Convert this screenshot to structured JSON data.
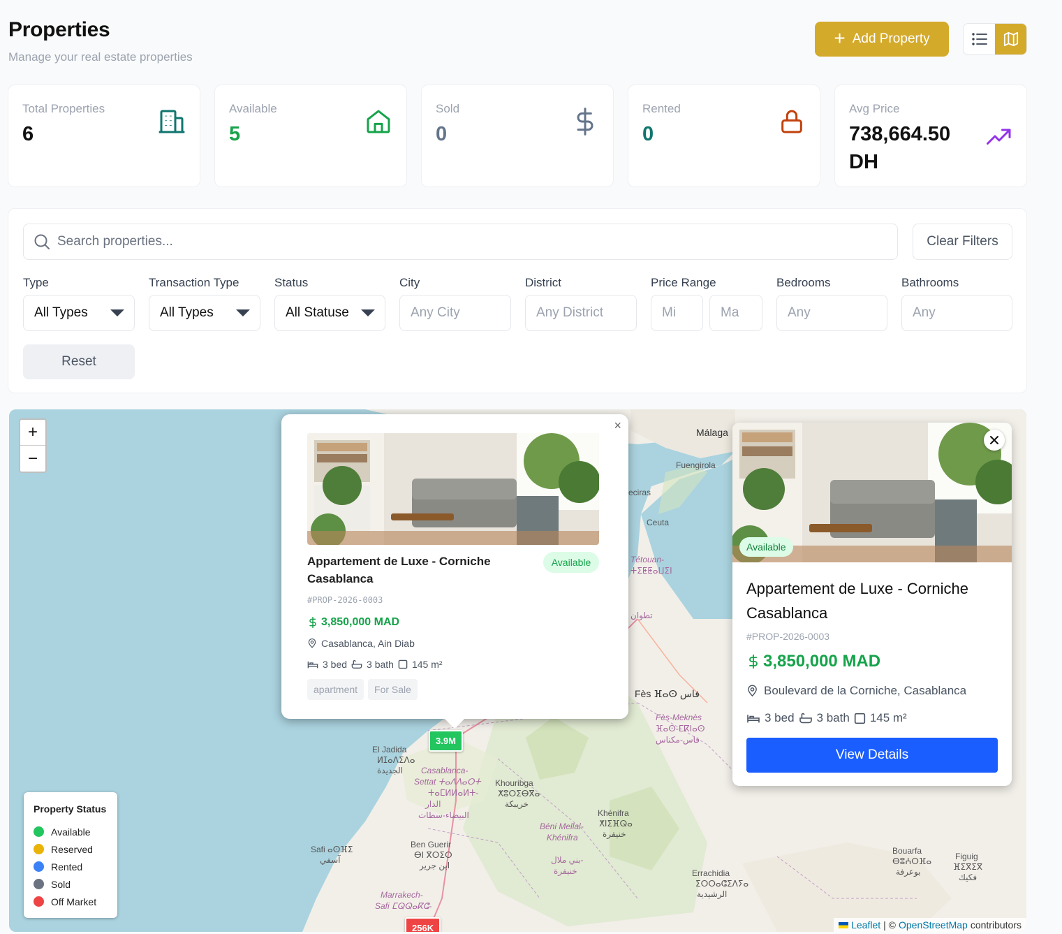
{
  "header": {
    "title": "Properties",
    "subtitle": "Manage your real estate properties",
    "add_label": "Add Property"
  },
  "stats": [
    {
      "label": "Total Properties",
      "value": "6",
      "icon": "building-icon",
      "color": "#0f766e"
    },
    {
      "label": "Available",
      "value": "5",
      "icon": "home-icon",
      "color": "#16a34a"
    },
    {
      "label": "Sold",
      "value": "0",
      "icon": "dollar-icon",
      "color": "#64748b"
    },
    {
      "label": "Rented",
      "value": "0",
      "icon": "lock-icon",
      "color": "#c2410c"
    },
    {
      "label": "Avg Price",
      "value_line1": "738,664.50",
      "value_line2": "DH",
      "icon": "trend-up-icon",
      "color": "#9333ea"
    }
  ],
  "filters": {
    "search_placeholder": "Search properties...",
    "clear_label": "Clear Filters",
    "type": {
      "label": "Type",
      "value": "All Types"
    },
    "transaction": {
      "label": "Transaction Type",
      "value": "All Types"
    },
    "status": {
      "label": "Status",
      "value": "All Statuse"
    },
    "city": {
      "label": "City",
      "placeholder": "Any City"
    },
    "district": {
      "label": "District",
      "placeholder": "Any District"
    },
    "price": {
      "label": "Price Range",
      "min_placeholder": "Mi",
      "max_placeholder": "Ma"
    },
    "bedrooms": {
      "label": "Bedrooms",
      "placeholder": "Any"
    },
    "bathrooms": {
      "label": "Bathrooms",
      "placeholder": "Any"
    },
    "reset_label": "Reset"
  },
  "map": {
    "zoom_in": "+",
    "zoom_out": "−",
    "labels": {
      "malaga": "Málaga",
      "fuengirola": "Fuengirola",
      "ceuta": "Ceuta",
      "algeciras": "eciras",
      "tetouan_1": "Tétouan-",
      "tetouan_2": "ⵜⵉⵟⵟⴰⵡⵉⵏ",
      "tetouan_3": "تطوان",
      "fes": "Fès ⴼⴰⵙ فاس",
      "fes_meknes_1": "Fès-Meknès",
      "fes_meknes_2": "ⴼⴰⵙ-ⵎⴽⵏⴰⵙ",
      "fes_meknes_3": "فاس-مكناس",
      "el_jadida_1": "El Jadida",
      "el_jadida_2": "ⵍⵊⴰⴷⵉⴷⴰ",
      "el_jadida_3": "الجديدة",
      "casa_1": "Casablanca-",
      "casa_2": "Settat ⵜⴰⴷⴷⴰⵔⵜ",
      "casa_3": "ⵜⴰⵎⵍⵍⴰⵍⵜ-",
      "casa_4": "الدار",
      "casa_5": "البيضاء-سطات",
      "khouribga_1": "Khouribga",
      "khouribga_2": "ⵅⵓⵔⵉⴱⴳⴰ",
      "khouribga_3": "خريبكة",
      "khenifra_1": "Khénifra",
      "khenifra_2": "ⵅⵏⵉⴼⵕⴰ",
      "khenifra_3": "خنيفرة",
      "beni_1": "Béni Mellal-",
      "beni_2": "Khénifra",
      "beni_3": "بني ملال-",
      "beni_4": "خنيفرة",
      "safi_1": "Safi ⴰⵙⴼⵉ",
      "safi_2": "آسفي",
      "ben_1": "Ben Guerir",
      "ben_2": "ⴱⵏ ⴳⵔⵉⵔ",
      "ben_3": "ابن جرير",
      "marrakech_1": "Marrakech-",
      "marrakech_2": "Safi ⵎⵕⵕⴰⴽⵛ-",
      "errachidia_1": "Errachidia",
      "errachidia_2": "ⵉⵔⵔⴰⵛⵉⴷⵢⴰ",
      "errachidia_3": "الرشيدية",
      "bouarfa_1": "Bouarfa",
      "bouarfa_2": "ⴱⵓⵄⵔⴼⴰ",
      "bouarfa_3": "بوعرفة",
      "figuig_1": "Figuig",
      "figuig_2": "ⴼⵉⴳⵉⴳ",
      "figuig_3": "فكيك"
    },
    "markers": {
      "main": "3.9M",
      "bottom": "256K"
    },
    "popup": {
      "title": "Appartement de Luxe - Corniche Casablanca",
      "badge": "Available",
      "ref": "#PROP-2026-0003",
      "price": "3,850,000 MAD",
      "location": "Casablanca, Ain Diab",
      "beds": "3 bed",
      "baths": "3 bath",
      "area": "145 m²",
      "tags": [
        "apartment",
        "For Sale"
      ]
    },
    "card": {
      "badge": "Available",
      "title": "Appartement de Luxe - Corniche Casablanca",
      "ref": "#PROP-2026-0003",
      "price": "3,850,000 MAD",
      "address": "Boulevard de la Corniche, Casablanca",
      "beds": "3 bed",
      "baths": "3 bath",
      "area": "145 m²",
      "button": "View Details"
    },
    "legend": {
      "title": "Property Status",
      "items": [
        {
          "label": "Available",
          "color": "#22c55e"
        },
        {
          "label": "Reserved",
          "color": "#eab308"
        },
        {
          "label": "Rented",
          "color": "#3b82f6"
        },
        {
          "label": "Sold",
          "color": "#6b7280"
        },
        {
          "label": "Off Market",
          "color": "#ef4444"
        }
      ]
    },
    "attribution": {
      "leaflet": "Leaflet",
      "sep": "| ©",
      "osm": "OpenStreetMap",
      "contrib": "contributors"
    }
  },
  "colors": {
    "accent": "#d4aa2b",
    "primary": "#1a5eff",
    "success": "#16a34a"
  }
}
